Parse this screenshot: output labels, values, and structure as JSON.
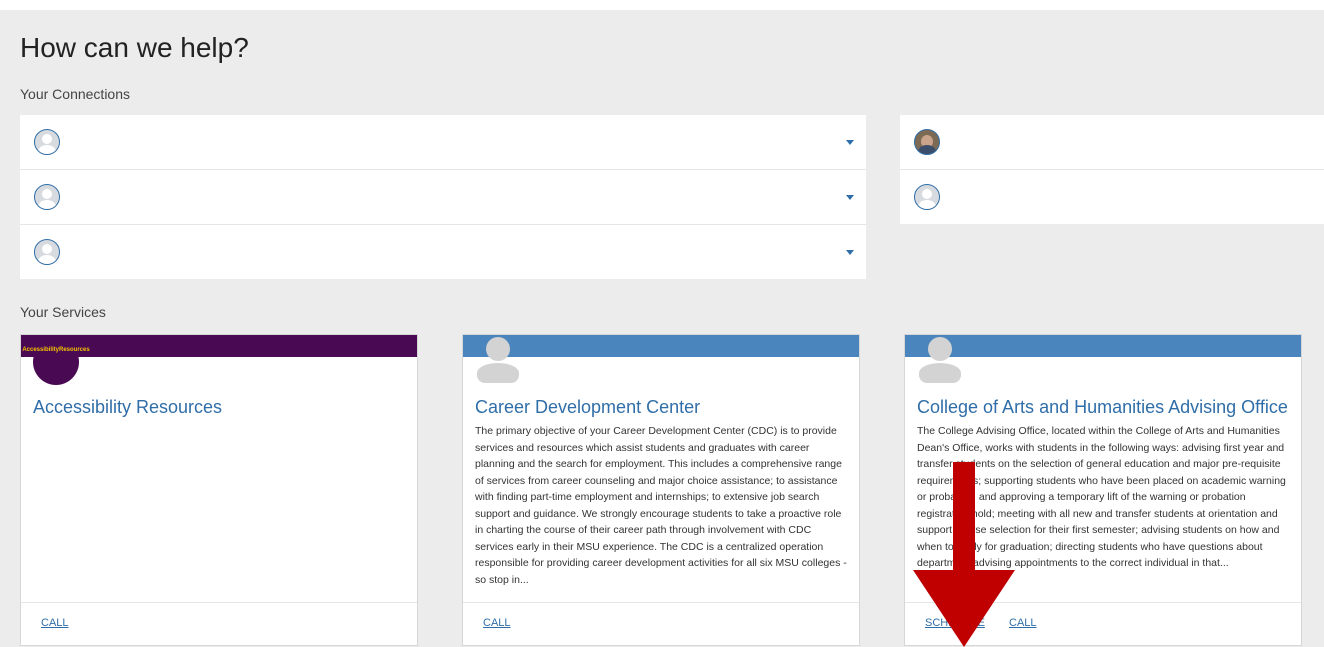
{
  "page": {
    "title": "How can we help?"
  },
  "connections": {
    "label": "Your Connections",
    "left": [
      {
        "avatar": "user-placeholder"
      },
      {
        "avatar": "user-placeholder"
      },
      {
        "avatar": "user-placeholder"
      }
    ],
    "right": [
      {
        "avatar": "user-photo"
      },
      {
        "avatar": "user-placeholder"
      }
    ]
  },
  "services": {
    "label": "Your Services",
    "cards": [
      {
        "title": "Accessibility Resources",
        "logo_text": "Accessibility Resources",
        "band_color": "#4a0a53",
        "description": "",
        "links": [
          "CALL"
        ]
      },
      {
        "title": "Career Development Center",
        "band_color": "#4a86bd",
        "description": "The primary objective of your Career Development Center (CDC) is to provide services and resources which assist students and graduates with career planning and the search for employment. This includes a comprehensive range of services from career counseling and major choice assistance; to assistance with finding part-time employment and internships; to extensive job search support and guidance. We strongly encourage students to take a proactive role in charting the course of their career path through involvement with CDC services early in their MSU experience. The CDC is a centralized operation responsible for providing career development activities for all six MSU colleges - so stop in...",
        "links": [
          "CALL"
        ]
      },
      {
        "title": "College of Arts and Humanities Advising Office",
        "band_color": "#4a86bd",
        "description": "The College Advising Office, located within the College of Arts and Humanities Dean's Office, works with students in the following ways: advising first year and transfer students on the selection of general education and major pre-requisite requirements; supporting students who have been placed on academic warning or probation, and approving a temporary lift of the warning or probation registration hold; meeting with all new and transfer students at orientation and support course selection for their first semester; advising students on how and when to apply for graduation; directing students who have questions about department advising appointments to the correct individual in that...",
        "links": [
          "SCHEDULE",
          "CALL"
        ]
      }
    ]
  },
  "colors": {
    "accent": "#2f6ea8",
    "arrow": "#c00000",
    "band_blue": "#4a86bd",
    "band_purple": "#4a0a53"
  }
}
